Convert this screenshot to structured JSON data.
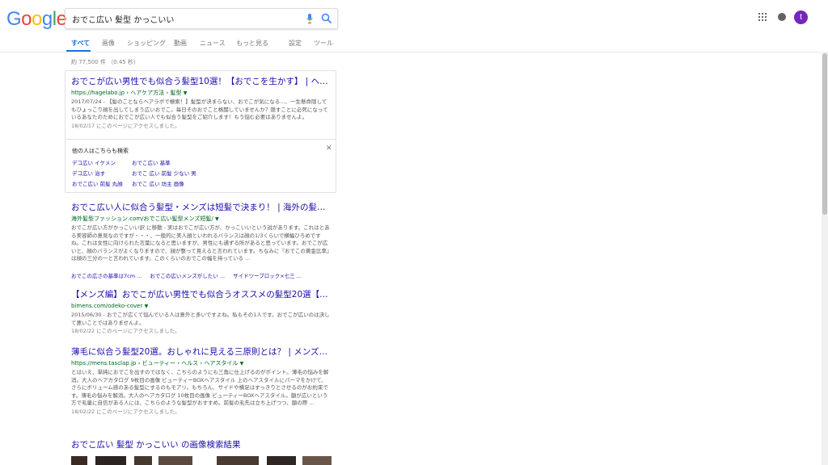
{
  "logo": {
    "letters": [
      "G",
      "o",
      "o",
      "g",
      "l",
      "e"
    ],
    "colors": [
      "#4285F4",
      "#EA4335",
      "#FBBC05",
      "#4285F4",
      "#34A853",
      "#EA4335"
    ]
  },
  "search": {
    "query": "おでこ広い 髪型 かっこいい"
  },
  "header": {
    "avatar_letter": "t",
    "avatar_color": "#7627bb"
  },
  "tabs": [
    {
      "label": "すべて",
      "active": true
    },
    {
      "label": "画像"
    },
    {
      "label": "ショッピング"
    },
    {
      "label": "動画"
    },
    {
      "label": "ニュース"
    },
    {
      "label": "もっと見る"
    },
    {
      "label": "設定"
    },
    {
      "label": "ツール"
    }
  ],
  "stats": "約 77,500 件 （0.45 秒）",
  "results": [
    {
      "title": "おでこが広い男性でも似合う髪型10選！【おでこを生かす】 | ヘアラボ...",
      "url": "https://hagelabo.jp › ヘアケア方法 › 髪型",
      "snippet": "2017/07/24 - 【髪のことならヘアラボで検索！】髪型が決まらない、おでこが気になる...、一生懸命隠してもひょっこり顔を出してしまう広いおでこ。毎日そのおでこと格闘していませんか？隠すことに必死になっているあなたのためにおでこが広い人でも似合う髪型をご紹介します！もう悩む必要はありませんよ。",
      "visited": "18/02/17 にこのページにアクセスしました。"
    },
    {
      "title": "おでこ広い人に似合う髪型・メンズは短髪で決まり！ | 海外の髪型と ...",
      "url": "海外髪型ファッション.com/おでこ広い髪型メンズ短髪/",
      "snippet": "おでこが広い方がかっこいい訳 に移動 - 実はおでこが広い方が、かっこいいという説があります。これはとある美容師の意見なのですが・・・、一般的に美人顔といわれるバランスは顔の1/3くらいで横幅ひろめですね。これは女性に向けられた言葉になると思いますが、男性にも通ずる所があると思っています。おでこが広いと、顔のバランスがよくなりますので、顔が整って見えると言われています。ちなみに『おでこの黄金比率』は顔の三分の一と言われています。このくらいのおでこの幅を持っている ...",
      "visited": ""
    },
    {
      "title": "【メンズ編】おでこが広い男性でも似合うオススメの髪型20選【面長】...",
      "url": "bimens.com/odeko-cover",
      "snippet": "2015/06/30 - おでこが広くて悩んでいる人は意外と多いですよね。私もその1人です。おでこが広いのは決して悪いことではありませんよ。",
      "visited": "18/02/22 にこのページにアクセスしました。"
    },
    {
      "title": "薄毛に似合う髪型20選。おしゃれに見える三原則とは？ | メンズファッ...",
      "url": "https://mens.tasclap.jp › ビューティー・ヘルス › ヘアスタイル",
      "snippet": "とはいえ、単純におでこを出すのではなく、こちらのようにも三角に仕上げるのがポイント。薄毛の悩みを解消。大人のヘアカタログ 9枚目の画像 ビューティーBOXヘアスタイル 上のヘアスタイルにパーマをかけて、さらにボリューム感のある髪型にするのもモアリ。もちろん、サイドや横足はすっきりとさせるのがお約束です。薄毛の悩みを解消。大人のヘアカタログ 10枚目の画像 ビューティーBOXヘアスタイル。額が広いという方で毛量に自信がある人には、こちらのような髪型がおすすめ。前髪の毛先は立ち上げつつ、額の際 ...",
      "visited": "18/02/22 にこのページにアクセスしました。"
    }
  ],
  "pasf": {
    "heading": "他の人はこちらも検索",
    "items": [
      "デコ広い イケメン",
      "デコ広い 治す",
      "おでこ広い 前髪 丸顔",
      "おでこ広い 基準",
      "おでこ 広い 前髪 少ない 男",
      "おでこ 広い 坊主 画像"
    ]
  },
  "sitelinks": [
    "おでこの広さの基準は7cm ...",
    "おでこの広いメンズがしたい ...",
    "サイドツーブロック×七三 ..."
  ],
  "image_heading": "おでこ広い 髪型 かっこいい の画像検索結果"
}
